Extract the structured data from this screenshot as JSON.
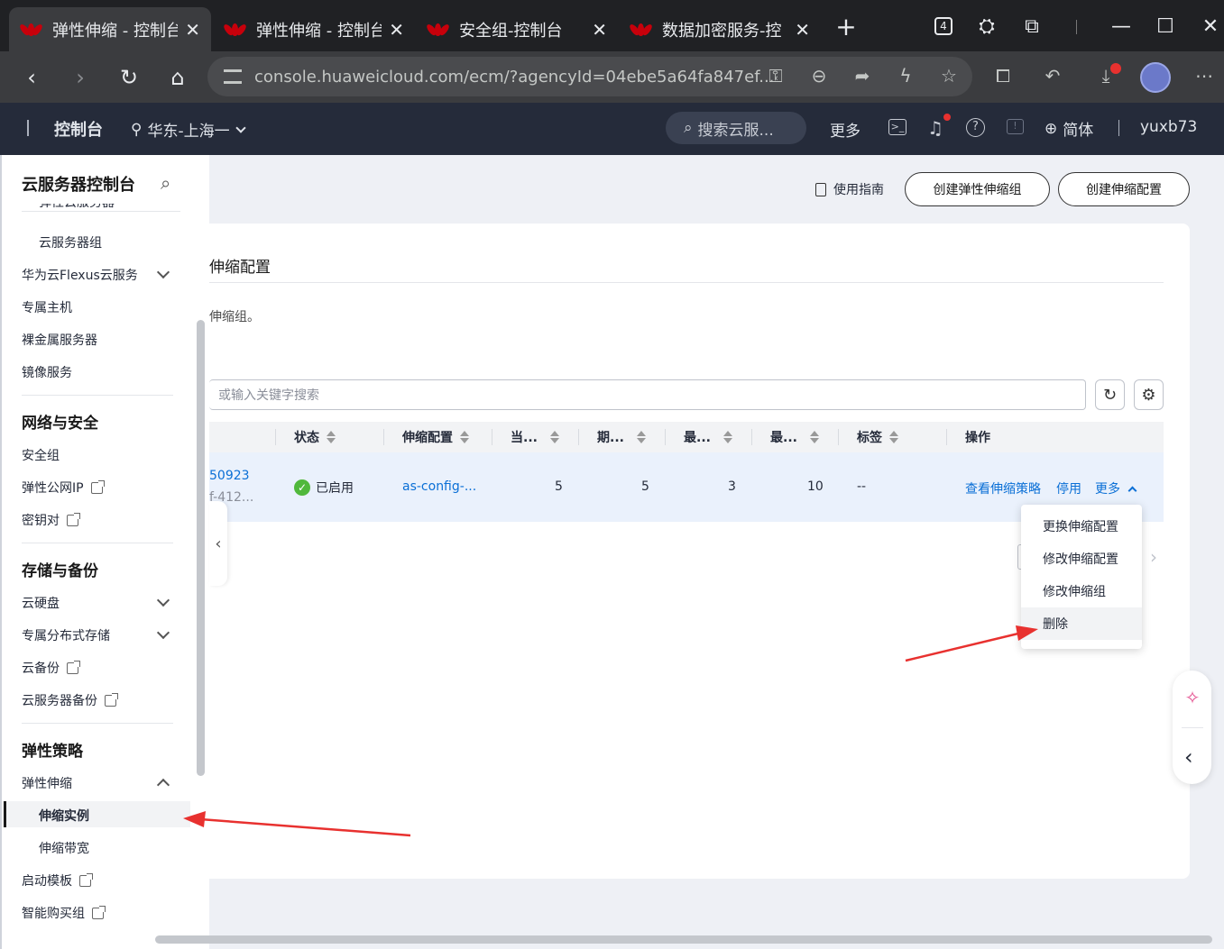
{
  "browser": {
    "tabs": [
      {
        "title": "弹性伸缩 - 控制台"
      },
      {
        "title": "弹性伸缩 - 控制台"
      },
      {
        "title": "安全组-控制台"
      },
      {
        "title": "数据加密服务-控"
      }
    ],
    "tab_count_badge": "4",
    "url": "console.huaweicloud.com/ecm/?agencyId=04ebe5a64fa847ef..."
  },
  "header": {
    "title": "控制台",
    "region": "华东-上海一",
    "search_placeholder": "搜索云服...",
    "more": "更多",
    "language": "简体",
    "username": "yuxb73"
  },
  "sidebar": {
    "title": "云服务器控制台",
    "partial_item": "弹性云服务器",
    "items_compute": [
      {
        "label": "云服务器组"
      },
      {
        "label": "华为云Flexus云服务"
      },
      {
        "label": "专属主机"
      },
      {
        "label": "裸金属服务器"
      },
      {
        "label": "镜像服务"
      }
    ],
    "sec_network": "网络与安全",
    "items_network": [
      {
        "label": "安全组"
      },
      {
        "label": "弹性公网IP"
      },
      {
        "label": "密钥对"
      }
    ],
    "sec_storage": "存储与备份",
    "items_storage": [
      {
        "label": "云硬盘"
      },
      {
        "label": "专属分布式存储"
      },
      {
        "label": "云备份"
      },
      {
        "label": "云服务器备份"
      }
    ],
    "sec_elastic": "弹性策略",
    "items_elastic": [
      {
        "label": "弹性伸缩"
      },
      {
        "label": "伸缩实例"
      },
      {
        "label": "伸缩带宽"
      },
      {
        "label": "启动模板"
      },
      {
        "label": "智能购买组"
      }
    ]
  },
  "toolbar": {
    "guide": "使用指南",
    "create_group": "创建弹性伸缩组",
    "create_config": "创建伸缩配置"
  },
  "content": {
    "heading": "伸缩配置",
    "hint": "伸缩组。",
    "search_placeholder": "或输入关键字搜索"
  },
  "table": {
    "columns": [
      "状态",
      "伸缩配置",
      "当...",
      "期...",
      "最...",
      "最...",
      "标签",
      "操作"
    ],
    "row": {
      "name_line1": "50923",
      "name_line2": "f-412...",
      "status": "已启用",
      "config": "as-config-...",
      "current": "5",
      "expected": "5",
      "min": "3",
      "max": "10",
      "tags": "--",
      "action_policy": "查看伸缩策略",
      "action_disable": "停用",
      "action_more": "更多"
    }
  },
  "dropdown": {
    "items": [
      {
        "label": "更换伸缩配置"
      },
      {
        "label": "修改伸缩配置"
      },
      {
        "label": "修改伸缩组"
      },
      {
        "label": "删除"
      }
    ]
  },
  "colors": {
    "accent": "#0a6fd6",
    "header_bg": "#252b3a",
    "annotation": "#e8312f",
    "success": "#50b83c"
  }
}
